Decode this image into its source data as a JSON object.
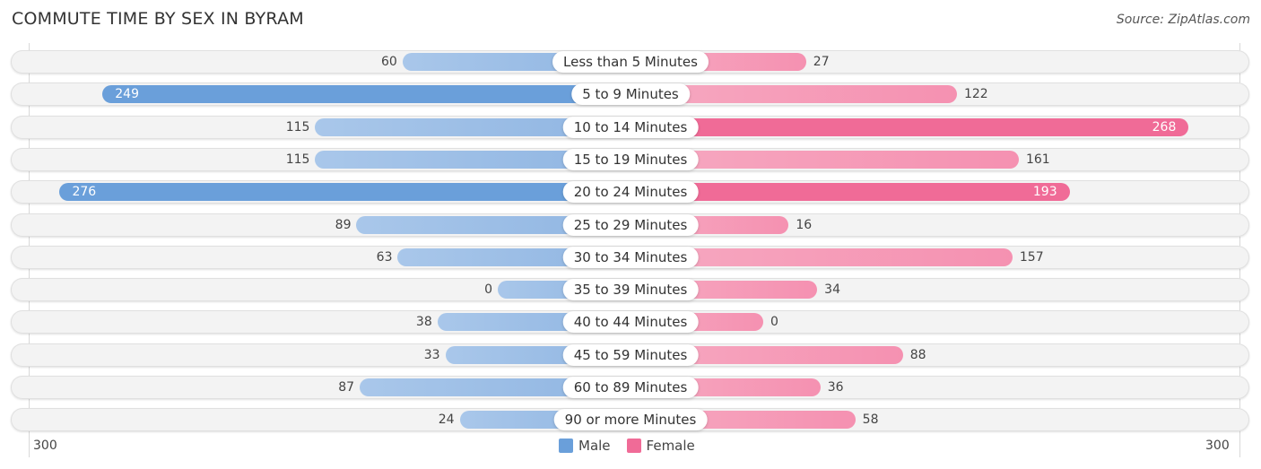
{
  "title": "COMMUTE TIME BY SEX IN BYRAM",
  "source": "Source: ZipAtlas.com",
  "colors": {
    "male": "#6a9fda",
    "female": "#f06b97"
  },
  "chart_data": {
    "type": "bar",
    "orientation": "horizontal-diverging",
    "title": "COMMUTE TIME BY SEX IN BYRAM",
    "categories": [
      "Less than 5 Minutes",
      "5 to 9 Minutes",
      "10 to 14 Minutes",
      "15 to 19 Minutes",
      "20 to 24 Minutes",
      "25 to 29 Minutes",
      "30 to 34 Minutes",
      "35 to 39 Minutes",
      "40 to 44 Minutes",
      "45 to 59 Minutes",
      "60 to 89 Minutes",
      "90 or more Minutes"
    ],
    "series": [
      {
        "name": "Male",
        "values": [
          60,
          249,
          115,
          115,
          276,
          89,
          63,
          0,
          38,
          33,
          87,
          24
        ]
      },
      {
        "name": "Female",
        "values": [
          27,
          122,
          268,
          161,
          193,
          16,
          157,
          34,
          0,
          88,
          36,
          58
        ]
      }
    ],
    "axis": {
      "left_label": "300",
      "right_label": "300",
      "range": [
        0,
        300
      ]
    },
    "legend": {
      "items": [
        "Male",
        "Female"
      ],
      "position": "bottom-center"
    },
    "grid": false
  }
}
